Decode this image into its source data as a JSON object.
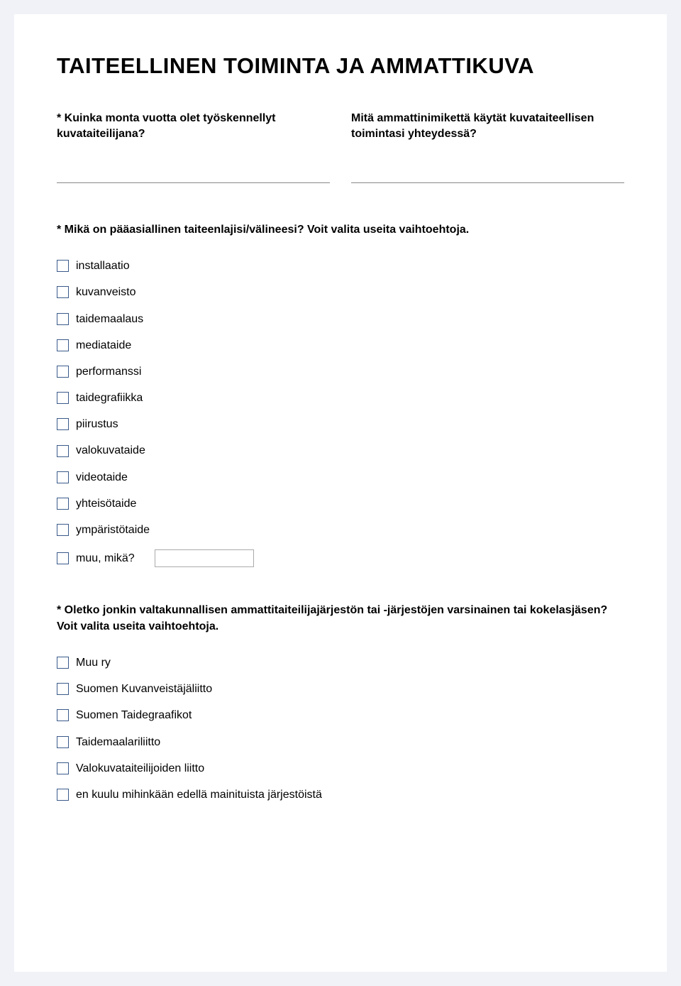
{
  "title": "TAITEELLINEN TOIMINTA JA AMMATTIKUVA",
  "q1": {
    "label": "* Kuinka monta vuotta olet työskennellyt kuvataiteilijana?"
  },
  "q2": {
    "label": "Mitä ammattinimikettä käytät kuvataiteellisen toimintasi yhteydessä?"
  },
  "q3": {
    "label": "* Mikä on pääasiallinen taiteenlajisi/välineesi? Voit valita useita vaihtoehtoja.",
    "options": [
      "installaatio",
      "kuvanveisto",
      "taidemaalaus",
      "mediataide",
      "performanssi",
      "taidegrafiikka",
      "piirustus",
      "valokuvataide",
      "videotaide",
      "yhteisötaide",
      "ympäristötaide",
      "muu, mikä?"
    ]
  },
  "q4": {
    "label": "* Oletko jonkin valtakunnallisen ammattitaiteilijajärjestön tai -järjestöjen varsinainen tai kokelasjäsen? Voit valita useita vaihtoehtoja.",
    "options": [
      "Muu ry",
      "Suomen Kuvanveistäjäliitto",
      "Suomen Taidegraafikot",
      "Taidemaalariliitto",
      "Valokuvataiteilijoiden liitto",
      "en kuulu mihinkään edellä mainituista järjestöistä"
    ]
  }
}
